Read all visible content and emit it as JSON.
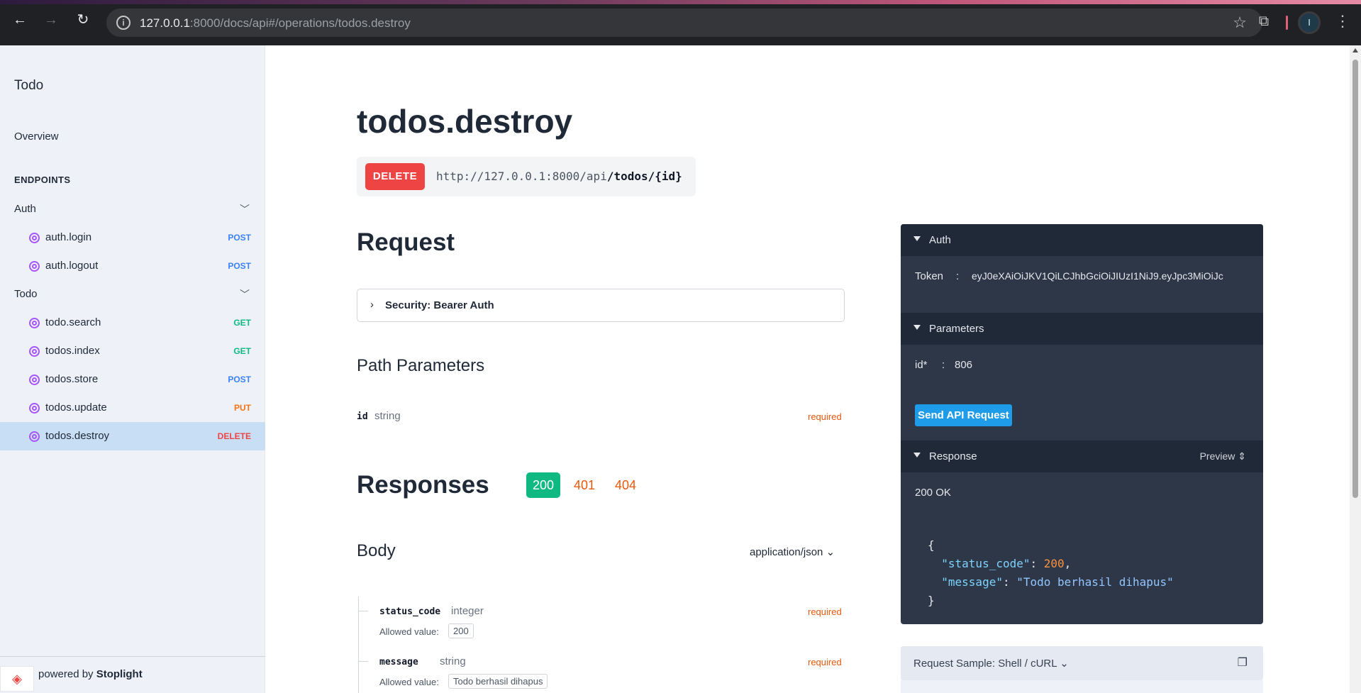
{
  "browser": {
    "url_host": "127.0.0.1",
    "url_path": ":8000/docs/api#/operations/todos.destroy",
    "profile_initial": "I"
  },
  "sidebar": {
    "logo": "Todo",
    "overview": "Overview",
    "section_title": "ENDPOINTS",
    "groups": [
      {
        "label": "Auth",
        "items": [
          {
            "label": "auth.login",
            "method": "POST"
          },
          {
            "label": "auth.logout",
            "method": "POST"
          }
        ]
      },
      {
        "label": "Todo",
        "items": [
          {
            "label": "todo.search",
            "method": "GET"
          },
          {
            "label": "todos.index",
            "method": "GET"
          },
          {
            "label": "todos.store",
            "method": "POST"
          },
          {
            "label": "todos.update",
            "method": "PUT"
          },
          {
            "label": "todos.destroy",
            "method": "DELETE"
          }
        ]
      }
    ],
    "active_item": "todos.destroy",
    "powered_prefix": "powered by ",
    "powered_brand": "Stoplight"
  },
  "main": {
    "title": "todos.destroy",
    "method": "DELETE",
    "base_url": "http://127.0.0.1:8000/api",
    "path": "/todos/{id}",
    "request_heading": "Request",
    "security_label": "Security: Bearer Auth",
    "path_params_heading": "Path Parameters",
    "path_params": [
      {
        "name": "id",
        "type": "string",
        "required": "required"
      }
    ],
    "responses_heading": "Responses",
    "response_codes": [
      "200",
      "401",
      "404"
    ],
    "active_code": "200",
    "body_heading": "Body",
    "content_type": "application/json",
    "body_fields": [
      {
        "name": "status_code",
        "type": "integer",
        "required": "required",
        "allowed_label": "Allowed value:",
        "allowed_value": "200"
      },
      {
        "name": "message",
        "type": "string",
        "required": "required",
        "allowed_label": "Allowed value:",
        "allowed_value": "Todo berhasil dihapus"
      }
    ]
  },
  "panel": {
    "auth_title": "Auth",
    "token_label": "Token",
    "token_sep": ":",
    "token_value": "eyJ0eXAiOiJKV1QiLCJhbGciOiJIUzI1NiJ9.eyJpc3MiOiJc",
    "params_title": "Parameters",
    "param_name": "id*",
    "param_sep": ":",
    "param_value": "806",
    "send_button": "Send API Request",
    "response_title": "Response",
    "preview_label": "Preview",
    "status_text": "200 OK",
    "response_body": {
      "status_code": 200,
      "message": "Todo berhasil dihapus"
    },
    "sample_title": "Request Sample: Shell / cURL"
  },
  "colors": {
    "delete": "#ef4444",
    "post": "#3b82f6",
    "get": "#10b981",
    "put": "#f97316",
    "success": "#10b981",
    "error_code": "#ea580c",
    "send_button": "#1e9be9",
    "panel_bg": "#2d3748"
  }
}
